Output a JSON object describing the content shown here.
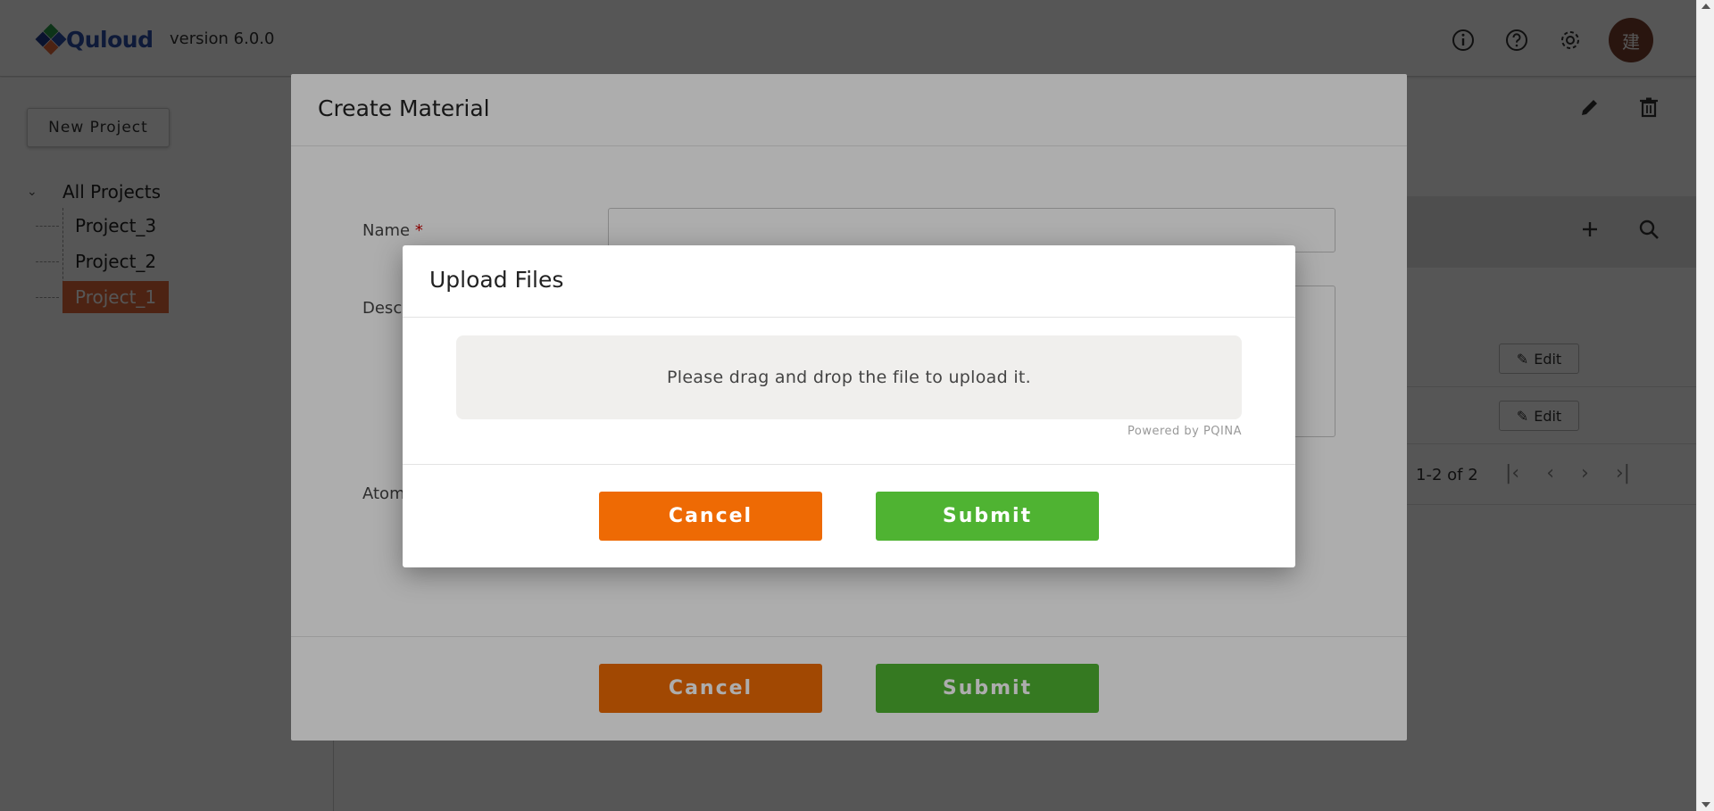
{
  "header": {
    "logo_text": "Quloud",
    "version": "version 6.0.0",
    "avatar_text": "建",
    "icons": [
      "info-icon",
      "help-icon",
      "gear-icon"
    ]
  },
  "sidebar": {
    "new_project_label": "New Project",
    "tree": {
      "root_label": "All Projects",
      "items": [
        {
          "label": "Project_3",
          "selected": false
        },
        {
          "label": "Project_2",
          "selected": false
        },
        {
          "label": "Project_1",
          "selected": true
        }
      ]
    }
  },
  "main": {
    "head_icons": [
      "pencil-icon",
      "trash-icon"
    ],
    "band_icons": [
      "plus-icon",
      "search-icon"
    ],
    "rows": [
      {
        "edit_label": "Edit"
      },
      {
        "edit_label": "Edit"
      }
    ],
    "pager": {
      "range_text": "1-2 of 2"
    }
  },
  "create_material_modal": {
    "title": "Create Material",
    "fields": {
      "name_label": "Name",
      "name_required_mark": "*",
      "description_label": "Descr",
      "atom_label": "Atom"
    },
    "cancel_label": "Cancel",
    "submit_label": "Submit"
  },
  "upload_modal": {
    "title": "Upload Files",
    "dropzone_text": "Please drag and drop the file to upload it.",
    "powered_by": "Powered by PQINA",
    "cancel_label": "Cancel",
    "submit_label": "Submit"
  },
  "colors": {
    "cancel": "#ee6a04",
    "submit": "#4fb332",
    "selected_tree": "#e5693b",
    "avatar": "#7a3e2e",
    "brand": "#2a4fa8"
  }
}
